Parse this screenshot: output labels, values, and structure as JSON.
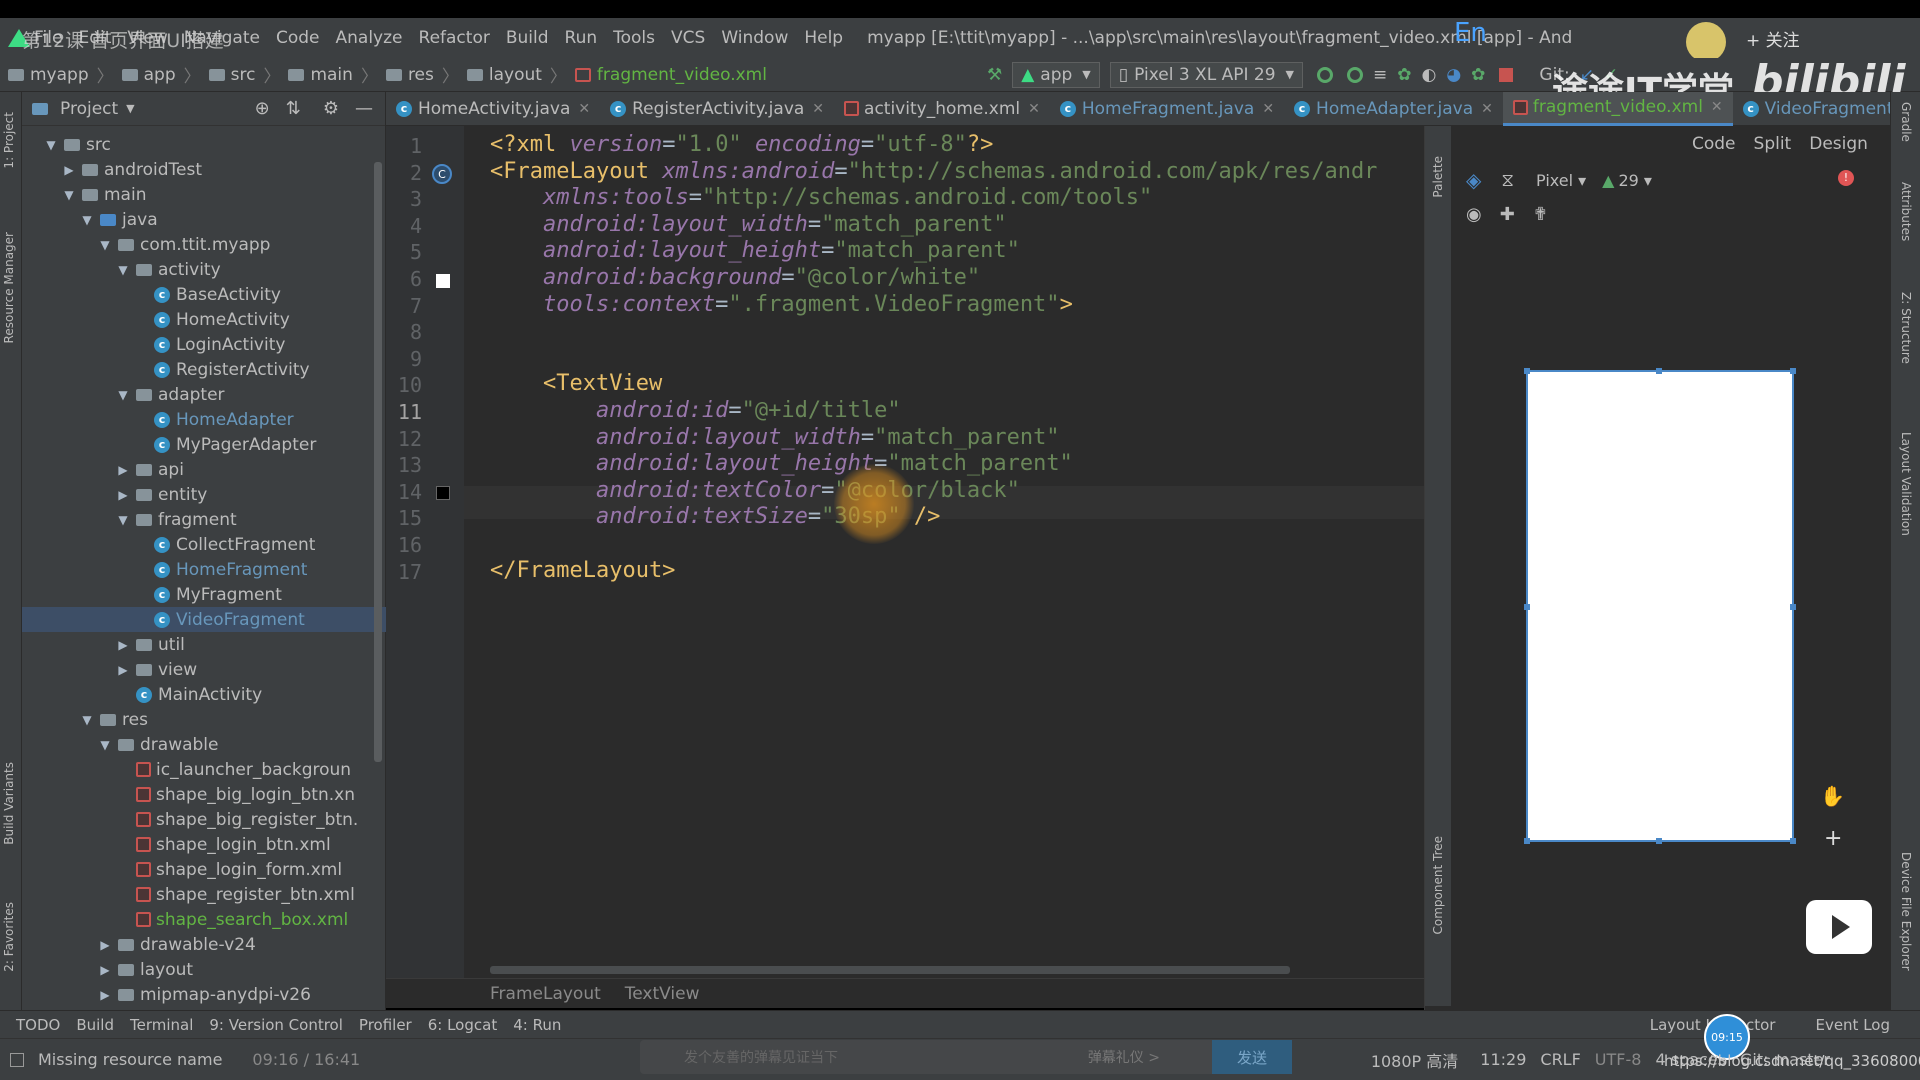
{
  "lesson_overlay": "第12课 首页界面UI搭建",
  "menu": {
    "items": [
      "File",
      "Edit",
      "View",
      "Navigate",
      "Code",
      "Analyze",
      "Refactor",
      "Build",
      "Run",
      "Tools",
      "VCS",
      "Window",
      "Help"
    ],
    "window_title": "myapp [E:\\ttit\\myapp] - ...\\app\\src\\main\\res\\layout\\fragment_video.xml [app] - And",
    "ime": "En",
    "follow": "+ 关注"
  },
  "navbar": {
    "crumbs": [
      "myapp",
      "app",
      "src",
      "main",
      "res",
      "layout",
      "fragment_video.xml"
    ],
    "run_config": "app",
    "device": "Pixel 3 XL API 29",
    "git_label": "Git:"
  },
  "watermark": {
    "brand": "途途IT学堂",
    "site": "bilibili"
  },
  "left_stripe": {
    "project": "1: Project",
    "resource_manager": "Resource Manager",
    "build_variants": "Build Variants",
    "favorites": "2: Favorites"
  },
  "project_panel": {
    "title": "Project",
    "tree": [
      {
        "label": "src",
        "depth": 2,
        "kind": "folder",
        "expanded": true
      },
      {
        "label": "androidTest",
        "depth": 3,
        "kind": "folder",
        "expanded": false
      },
      {
        "label": "main",
        "depth": 3,
        "kind": "folder",
        "expanded": true
      },
      {
        "label": "java",
        "depth": 4,
        "kind": "folder-blue",
        "expanded": true
      },
      {
        "label": "com.ttit.myapp",
        "depth": 5,
        "kind": "package",
        "expanded": true
      },
      {
        "label": "activity",
        "depth": 6,
        "kind": "package",
        "expanded": true
      },
      {
        "label": "BaseActivity",
        "depth": 7,
        "kind": "class"
      },
      {
        "label": "HomeActivity",
        "depth": 7,
        "kind": "class"
      },
      {
        "label": "LoginActivity",
        "depth": 7,
        "kind": "class"
      },
      {
        "label": "RegisterActivity",
        "depth": 7,
        "kind": "class"
      },
      {
        "label": "adapter",
        "depth": 6,
        "kind": "package",
        "expanded": true
      },
      {
        "label": "HomeAdapter",
        "depth": 7,
        "kind": "class",
        "color": "blue"
      },
      {
        "label": "MyPagerAdapter",
        "depth": 7,
        "kind": "class"
      },
      {
        "label": "api",
        "depth": 6,
        "kind": "package",
        "expanded": false
      },
      {
        "label": "entity",
        "depth": 6,
        "kind": "package",
        "expanded": false
      },
      {
        "label": "fragment",
        "depth": 6,
        "kind": "package",
        "expanded": true
      },
      {
        "label": "CollectFragment",
        "depth": 7,
        "kind": "class"
      },
      {
        "label": "HomeFragment",
        "depth": 7,
        "kind": "class",
        "color": "blue"
      },
      {
        "label": "MyFragment",
        "depth": 7,
        "kind": "class"
      },
      {
        "label": "VideoFragment",
        "depth": 7,
        "kind": "class",
        "color": "blue",
        "selected": true
      },
      {
        "label": "util",
        "depth": 6,
        "kind": "package",
        "expanded": false
      },
      {
        "label": "view",
        "depth": 6,
        "kind": "package",
        "expanded": false
      },
      {
        "label": "MainActivity",
        "depth": 6,
        "kind": "class"
      },
      {
        "label": "res",
        "depth": 4,
        "kind": "folder",
        "expanded": true
      },
      {
        "label": "drawable",
        "depth": 5,
        "kind": "folder",
        "expanded": true
      },
      {
        "label": "ic_launcher_backgroun",
        "depth": 6,
        "kind": "xml"
      },
      {
        "label": "shape_big_login_btn.xn",
        "depth": 6,
        "kind": "xml"
      },
      {
        "label": "shape_big_register_btn.",
        "depth": 6,
        "kind": "xml"
      },
      {
        "label": "shape_login_btn.xml",
        "depth": 6,
        "kind": "xml"
      },
      {
        "label": "shape_login_form.xml",
        "depth": 6,
        "kind": "xml"
      },
      {
        "label": "shape_register_btn.xml",
        "depth": 6,
        "kind": "xml"
      },
      {
        "label": "shape_search_box.xml",
        "depth": 6,
        "kind": "xml",
        "color": "green"
      },
      {
        "label": "drawable-v24",
        "depth": 5,
        "kind": "folder",
        "expanded": false
      },
      {
        "label": "layout",
        "depth": 5,
        "kind": "folder",
        "expanded": false
      },
      {
        "label": "mipmap-anydpi-v26",
        "depth": 5,
        "kind": "folder",
        "expanded": false
      }
    ]
  },
  "tabs": [
    {
      "label": "HomeActivity.java",
      "kind": "class"
    },
    {
      "label": "RegisterActivity.java",
      "kind": "class"
    },
    {
      "label": "activity_home.xml",
      "kind": "xml"
    },
    {
      "label": "HomeFragment.java",
      "kind": "class",
      "color": "blue"
    },
    {
      "label": "HomeAdapter.java",
      "kind": "class",
      "color": "blue"
    },
    {
      "label": "fragment_video.xml",
      "kind": "xml",
      "color": "green",
      "active": true
    },
    {
      "label": "VideoFragment.java",
      "kind": "class",
      "color": "blue"
    }
  ],
  "editor": {
    "line_numbers": [
      "1",
      "2",
      "3",
      "4",
      "5",
      "6",
      "7",
      "8",
      "9",
      "10",
      "11",
      "12",
      "13",
      "14",
      "15",
      "16",
      "17"
    ],
    "current_line": "11",
    "lines": [
      [
        {
          "t": "tag",
          "s": "<?xml "
        },
        {
          "t": "ns",
          "s": "version"
        },
        {
          "t": "plain",
          "s": "="
        },
        {
          "t": "str",
          "s": "\"1.0\""
        },
        {
          "t": "plain",
          "s": " "
        },
        {
          "t": "ns",
          "s": "encoding"
        },
        {
          "t": "plain",
          "s": "="
        },
        {
          "t": "str",
          "s": "\"utf-8\""
        },
        {
          "t": "tag",
          "s": "?>"
        }
      ],
      [
        {
          "t": "tag",
          "s": "<FrameLayout "
        },
        {
          "t": "ns",
          "s": "xmlns:android"
        },
        {
          "t": "plain",
          "s": "="
        },
        {
          "t": "str",
          "s": "\"http://schemas.android.com/apk/res/andr"
        }
      ],
      [
        {
          "t": "plain",
          "s": "    "
        },
        {
          "t": "ns",
          "s": "xmlns:tools"
        },
        {
          "t": "plain",
          "s": "="
        },
        {
          "t": "str",
          "s": "\"http://schemas.android.com/tools\""
        }
      ],
      [
        {
          "t": "plain",
          "s": "    "
        },
        {
          "t": "ns",
          "s": "android:layout_width"
        },
        {
          "t": "plain",
          "s": "="
        },
        {
          "t": "str",
          "s": "\"match_parent\""
        }
      ],
      [
        {
          "t": "plain",
          "s": "    "
        },
        {
          "t": "ns",
          "s": "android:layout_height"
        },
        {
          "t": "plain",
          "s": "="
        },
        {
          "t": "str",
          "s": "\"match_parent\""
        }
      ],
      [
        {
          "t": "plain",
          "s": "    "
        },
        {
          "t": "ns",
          "s": "android:background"
        },
        {
          "t": "plain",
          "s": "="
        },
        {
          "t": "str",
          "s": "\"@color/white\""
        }
      ],
      [
        {
          "t": "plain",
          "s": "    "
        },
        {
          "t": "ns",
          "s": "tools:context"
        },
        {
          "t": "plain",
          "s": "="
        },
        {
          "t": "str",
          "s": "\".fragment.VideoFragment\""
        },
        {
          "t": "tag",
          "s": ">"
        }
      ],
      [],
      [],
      [
        {
          "t": "plain",
          "s": "    "
        },
        {
          "t": "tag",
          "s": "<TextView"
        }
      ],
      [
        {
          "t": "plain",
          "s": "        "
        },
        {
          "t": "ns",
          "s": "android:id"
        },
        {
          "t": "plain",
          "s": "="
        },
        {
          "t": "str",
          "s": "\"@+id/title\""
        }
      ],
      [
        {
          "t": "plain",
          "s": "        "
        },
        {
          "t": "ns",
          "s": "android:layout_width"
        },
        {
          "t": "plain",
          "s": "="
        },
        {
          "t": "str",
          "s": "\"match_parent\""
        }
      ],
      [
        {
          "t": "plain",
          "s": "        "
        },
        {
          "t": "ns",
          "s": "android:layout_height"
        },
        {
          "t": "plain",
          "s": "="
        },
        {
          "t": "str",
          "s": "\"match_parent\""
        }
      ],
      [
        {
          "t": "plain",
          "s": "        "
        },
        {
          "t": "ns",
          "s": "android:textColor"
        },
        {
          "t": "plain",
          "s": "="
        },
        {
          "t": "str",
          "s": "\"@color/black\""
        }
      ],
      [
        {
          "t": "plain",
          "s": "        "
        },
        {
          "t": "ns",
          "s": "android:textSize"
        },
        {
          "t": "plain",
          "s": "="
        },
        {
          "t": "str",
          "s": "\"30sp\""
        },
        {
          "t": "plain",
          "s": " "
        },
        {
          "t": "tag",
          "s": "/>"
        }
      ],
      [],
      [
        {
          "t": "tag",
          "s": "</FrameLayout>"
        }
      ]
    ],
    "breadcrumb": [
      "FrameLayout",
      "TextView"
    ]
  },
  "design_pane": {
    "modes": [
      "Code",
      "Split",
      "Design"
    ],
    "palette_label": "Palette",
    "component_tree_label": "Component Tree",
    "device": "Pixel",
    "api": "29"
  },
  "right_stripe": {
    "gradle": "Gradle",
    "attributes": "Attributes",
    "structure": "Z: Structure",
    "layout_validation": "Layout Validation",
    "device_file_explorer": "Device File Explorer"
  },
  "tool_windows": [
    "TODO",
    "Build",
    "Terminal",
    "9: Version Control",
    "Profiler",
    "6: Logcat",
    "4: Run"
  ],
  "tool_windows_right": [
    "Layout Inspector",
    "Event Log"
  ],
  "status": {
    "message": "Missing resource name",
    "time_played": "09:16 / 16:41",
    "danmu_placeholder": "发个友善的弹幕见证当下",
    "danmu_etiquette": "弹幕礼仪 >",
    "send": "发送",
    "quality": "1080P 高清",
    "position": "11:29",
    "line_sep": "CRLF",
    "encoding": "UTF-8",
    "indent": "4 spaces",
    "branch": "Git: master",
    "clock": "09:15",
    "url": "https://blog.csdn.net/qq_33608000"
  },
  "colors": {
    "accent": "#4a88c7",
    "bg_editor": "#2b2b2b",
    "panel": "#3c3f41",
    "tag": "#e8bf6a",
    "string": "#6a8759",
    "attr": "#9876aa"
  }
}
